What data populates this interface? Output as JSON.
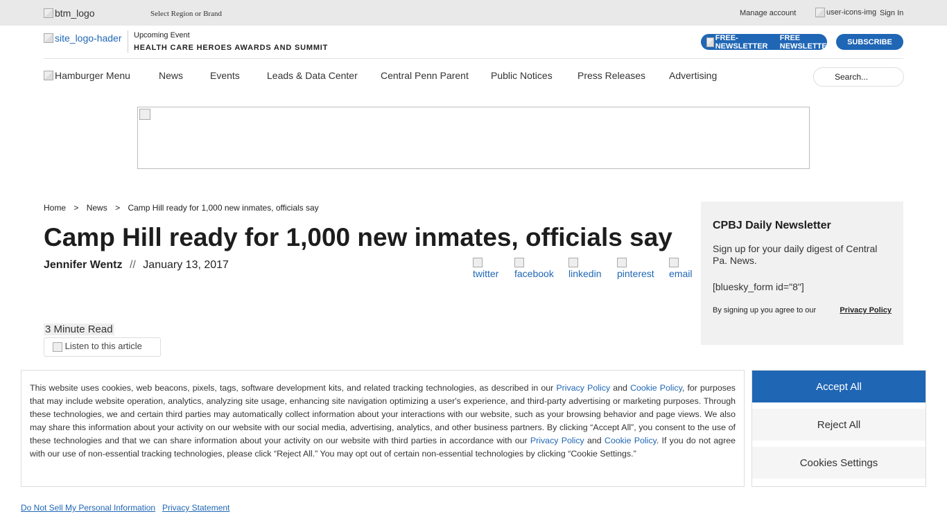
{
  "topbar": {
    "logo_alt": "btm_logo",
    "region_select": "Select Region or Brand",
    "manage_account": "Manage account",
    "user_icon_alt": "user-icons-img",
    "sign_in": "Sign In"
  },
  "header": {
    "site_logo_alt": "site_logo-hader",
    "upcoming_label": "Upcoming Event",
    "upcoming_event": "HEALTH CARE HEROES AWARDS AND SUMMIT",
    "newsletter_img_alt": "FREE-NEWSLETTER",
    "newsletter_btn": "FREE NEWSLETTER",
    "subscribe_btn": "SUBSCRIBE"
  },
  "nav": {
    "hamburger_alt": "Hamburger Menu",
    "items": [
      "News",
      "Events",
      "Leads & Data Center",
      "Central Penn Parent",
      "Public Notices",
      "Press Releases",
      "Advertising"
    ],
    "search_placeholder": "Search..."
  },
  "breadcrumb": {
    "home": "Home",
    "sep": ">",
    "section": "News",
    "current": "Camp Hill ready for 1,000 new inmates, officials say"
  },
  "article": {
    "title": "Camp Hill ready for 1,000 new inmates, officials say",
    "author": "Jennifer Wentz",
    "separator": "//",
    "date": "January 13, 2017",
    "share": [
      "twitter",
      "facebook",
      "linkedin",
      "pinterest",
      "email"
    ],
    "read_time": "3 Minute Read",
    "listen": "Listen to this article"
  },
  "sidebar": {
    "heading": "CPBJ Daily Newsletter",
    "text": "Sign up for your daily digest of Central Pa. News.",
    "form_shortcode": "[bluesky_form id=\"8\"]",
    "agree_text": "By signing up you agree to our",
    "privacy_link": "Privacy Policy"
  },
  "cookie_banner": {
    "text_1": "This website uses cookies, web beacons, pixels, tags, software development kits, and related tracking technologies, as described in our ",
    "privacy_policy": "Privacy Policy",
    "and": " and ",
    "cookie_policy": "Cookie Policy",
    "text_2": ", for purposes that may include website operation, analytics, analyzing site usage, enhancing site navigation optimizing a user's experience, and third-party advertising or marketing purposes. Through these technologies, we and certain third parties may automatically collect information about your interactions with our website, such as your browsing behavior and page views. We also may share this information about your activity on our website with our social media, advertising, analytics, and other business partners. By clicking “Accept All”, you consent to the use of these technologies and that we can share information about your activity on our website with third parties in accordance with our ",
    "text_3": ". If you do not agree with our use of non-essential tracking technologies, please click “Reject All.” You may opt out of certain non-essential technologies by clicking “Cookie Settings.”",
    "accept_all": "Accept All",
    "reject_all": "Reject All",
    "cookie_settings": "Cookies Settings",
    "accent_color": "#1f66b5"
  },
  "footer_links": {
    "do_not_sell": "Do Not Sell My Personal Information",
    "privacy_statement": "Privacy Statement"
  }
}
